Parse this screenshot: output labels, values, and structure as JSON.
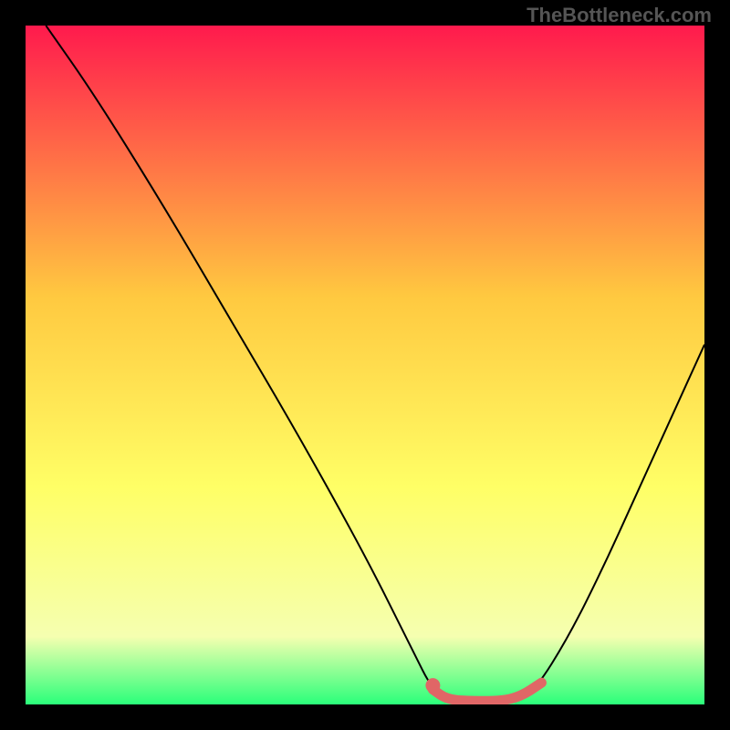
{
  "watermark": "TheBottleneck.com",
  "chart_data": {
    "type": "line",
    "title": "",
    "xlabel": "",
    "ylabel": "",
    "xlim": [
      0,
      100
    ],
    "ylim": [
      0,
      100
    ],
    "background_gradient": {
      "top": "#ff1a4d",
      "mid1": "#ffc940",
      "mid2": "#ffff66",
      "mid3": "#f5ffb0",
      "bottom": "#2aff7a"
    },
    "series": [
      {
        "name": "bottleneck-curve",
        "stroke": "#000000",
        "stroke_width": 2,
        "points": [
          {
            "x": 3,
            "y": 100
          },
          {
            "x": 10,
            "y": 90
          },
          {
            "x": 20,
            "y": 74
          },
          {
            "x": 30,
            "y": 57
          },
          {
            "x": 40,
            "y": 40
          },
          {
            "x": 50,
            "y": 22
          },
          {
            "x": 57,
            "y": 8
          },
          {
            "x": 60,
            "y": 2
          },
          {
            "x": 63,
            "y": 0.5
          },
          {
            "x": 72,
            "y": 0.5
          },
          {
            "x": 75,
            "y": 2
          },
          {
            "x": 80,
            "y": 10
          },
          {
            "x": 85,
            "y": 20
          },
          {
            "x": 90,
            "y": 31
          },
          {
            "x": 95,
            "y": 42
          },
          {
            "x": 100,
            "y": 53
          }
        ]
      },
      {
        "name": "highlight-segment",
        "stroke": "#e06666",
        "stroke_width": 11,
        "linecap": "round",
        "points": [
          {
            "x": 60,
            "y": 2.2
          },
          {
            "x": 62,
            "y": 0.8
          },
          {
            "x": 65,
            "y": 0.5
          },
          {
            "x": 70,
            "y": 0.5
          },
          {
            "x": 73,
            "y": 1.2
          },
          {
            "x": 76,
            "y": 3.2
          }
        ]
      },
      {
        "name": "highlight-dot",
        "type_hint": "point",
        "fill": "#e06666",
        "r": 8,
        "points": [
          {
            "x": 60,
            "y": 2.8
          }
        ]
      }
    ]
  }
}
